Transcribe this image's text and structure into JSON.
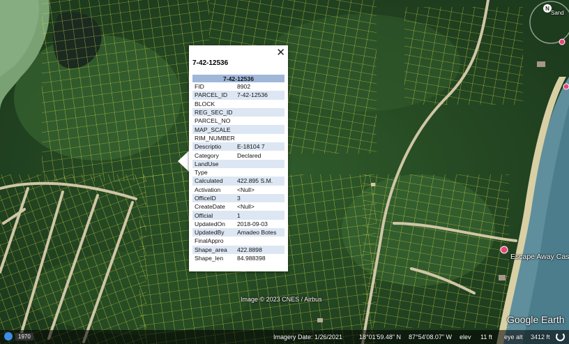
{
  "popup": {
    "close_label": "✕",
    "title": "7-42-12536",
    "table_header": "7-42-12536",
    "rows": [
      {
        "key": "FID",
        "value": "8902"
      },
      {
        "key": "PARCEL_ID",
        "value": "7-42-12536"
      },
      {
        "key": "BLOCK",
        "value": ""
      },
      {
        "key": "REG_SEC_ID",
        "value": ""
      },
      {
        "key": "PARCEL_NO",
        "value": ""
      },
      {
        "key": "MAP_SCALE",
        "value": ""
      },
      {
        "key": "RIM_NUMBER",
        "value": ""
      },
      {
        "key": "Descriptio",
        "value": "E-18104 7"
      },
      {
        "key": "Category",
        "value": "Declared"
      },
      {
        "key": "LandUse",
        "value": ""
      },
      {
        "key": "Type",
        "value": ""
      },
      {
        "key": "Calculated",
        "value": "422.895 S.M."
      },
      {
        "key": "Activation",
        "value": "<Null>"
      },
      {
        "key": "OfficeID",
        "value": "3"
      },
      {
        "key": "CreateDate",
        "value": "<Null>"
      },
      {
        "key": "Official",
        "value": "1"
      },
      {
        "key": "UpdatedOn",
        "value": "2018-09-03"
      },
      {
        "key": "UpdatedBy",
        "value": "Amadeo Botes"
      },
      {
        "key": "FinalAppro",
        "value": ""
      },
      {
        "key": "Shape_area",
        "value": "422.8898"
      },
      {
        "key": "Shape_len",
        "value": "84.988398"
      }
    ]
  },
  "map_labels": {
    "sand": "Sand",
    "escape": "Escape Away Cas",
    "copyright": "Image © 2023 CNES / Airbus",
    "google_earth": "Google Earth",
    "compass_n": "N"
  },
  "status_bar": {
    "year": "1970",
    "imagery_date": "Imagery Date: 1/26/2021",
    "lat": "18°01'59.48\" N",
    "lon": "87°54'08.07\" W",
    "elev": "elev",
    "elev_val": "11 ft",
    "eye_alt": "eye alt",
    "eye_alt_val": "3412 ft"
  },
  "colors": {
    "parcel_line": "#e9e84a",
    "popup_header": "#9fb8d9",
    "popup_alt_row": "#dde7f3",
    "place_pin": "#e8457a"
  }
}
